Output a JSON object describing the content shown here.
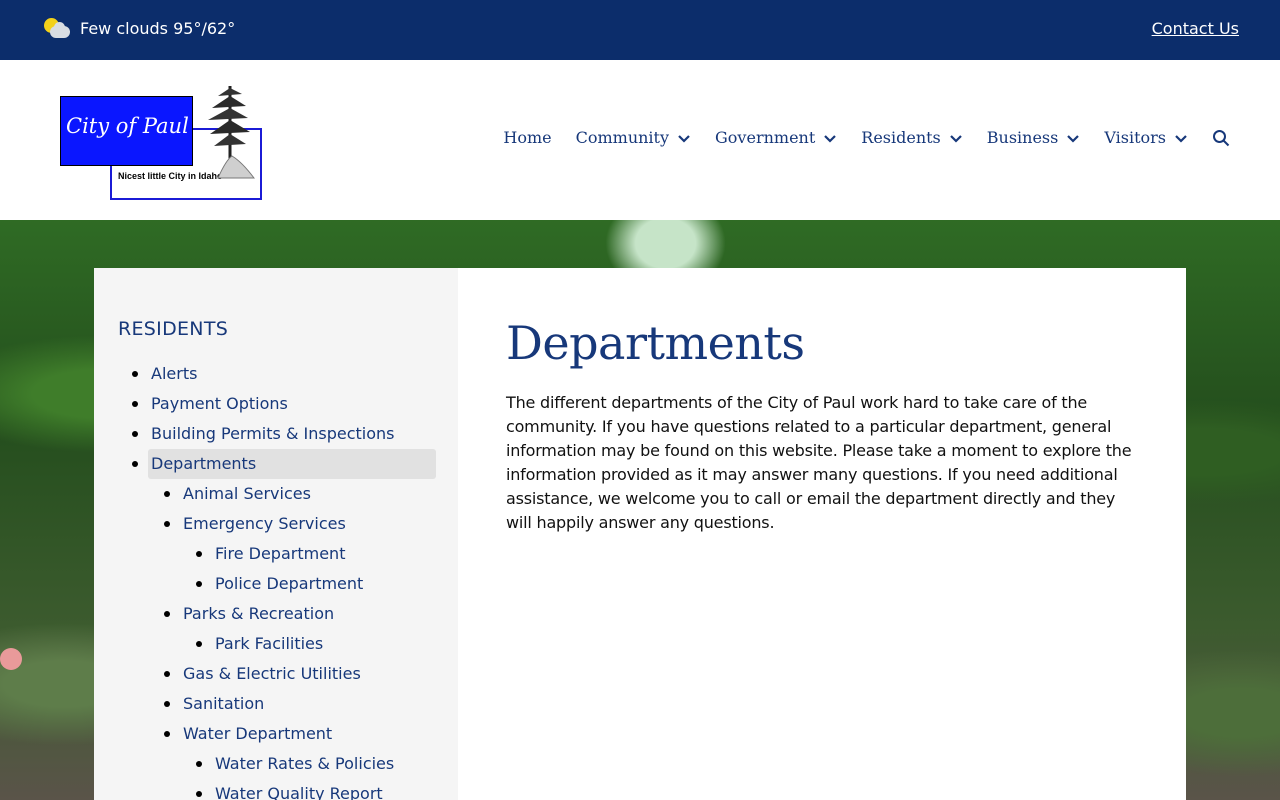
{
  "topbar": {
    "weather_icon": "partly-cloudy-icon",
    "weather_text": "Few clouds 95°/62°",
    "contact_label": "Contact Us"
  },
  "logo": {
    "title": "City of Paul",
    "tagline": "Nicest little City in Idaho"
  },
  "nav": {
    "items": [
      {
        "label": "Home",
        "has_dropdown": false
      },
      {
        "label": "Community",
        "has_dropdown": true
      },
      {
        "label": "Government",
        "has_dropdown": true
      },
      {
        "label": "Residents",
        "has_dropdown": true
      },
      {
        "label": "Business",
        "has_dropdown": true
      },
      {
        "label": "Visitors",
        "has_dropdown": true
      }
    ],
    "search_icon": "search-icon"
  },
  "sidebar": {
    "title": "RESIDENTS",
    "items": [
      {
        "label": "Alerts",
        "level": 1
      },
      {
        "label": "Payment Options",
        "level": 1
      },
      {
        "label": "Building Permits & Inspections",
        "level": 1
      },
      {
        "label": "Departments",
        "level": 1,
        "active": true
      },
      {
        "label": "Animal Services",
        "level": 2
      },
      {
        "label": "Emergency Services",
        "level": 2
      },
      {
        "label": "Fire Department",
        "level": 3
      },
      {
        "label": "Police Department",
        "level": 3
      },
      {
        "label": "Parks & Recreation",
        "level": 2
      },
      {
        "label": "Park Facilities",
        "level": 3
      },
      {
        "label": "Gas & Electric Utilities",
        "level": 2
      },
      {
        "label": "Sanitation",
        "level": 2
      },
      {
        "label": "Water Department",
        "level": 2
      },
      {
        "label": "Water Rates & Policies",
        "level": 3
      },
      {
        "label": "Water Quality Report",
        "level": 3
      }
    ]
  },
  "main": {
    "title": "Departments",
    "intro": "The different departments of the City of Paul work hard to take care of the community.  If you have questions related to a particular department, general information may be found on this website.  Please take a moment to explore the information provided as it may answer many questions.  If you need additional assistance, we welcome you to call or email the department directly and they will happily answer any questions."
  },
  "colors": {
    "topbar_bg": "#0c2d6b",
    "brand_text": "#17387a",
    "sidebar_bg": "#f5f5f5",
    "active_bg": "#e1e1e1"
  }
}
